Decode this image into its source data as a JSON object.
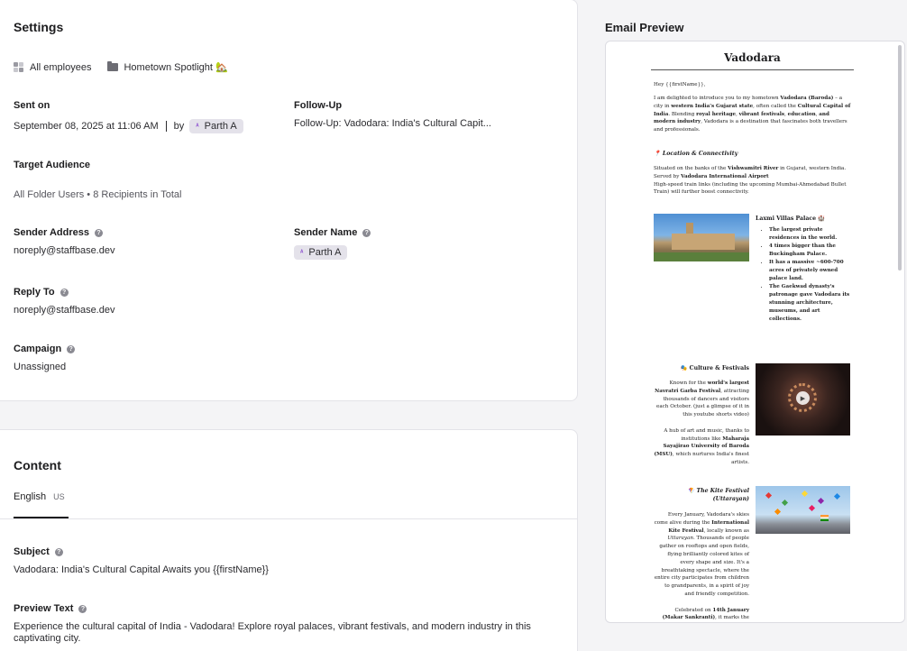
{
  "settings": {
    "title": "Settings",
    "audience_chip": "All employees",
    "folder_chip": "Hometown Spotlight 🏡",
    "sent_on_label": "Sent on",
    "sent_on_value": "September 08, 2025 at 11:06 AM",
    "by_label": "by",
    "author": "Parth A",
    "author_initials": "ᴬ",
    "followup_label": "Follow-Up",
    "followup_value": "Follow-Up: Vadodara: India's Cultural Capit...",
    "target_label": "Target Audience",
    "target_value": "All Folder Users • 8 Recipients in Total",
    "sender_address_label": "Sender Address",
    "sender_address_value": "noreply@staffbase.dev",
    "sender_name_label": "Sender Name",
    "sender_name_value": "Parth A",
    "reply_to_label": "Reply To",
    "reply_to_value": "noreply@staffbase.dev",
    "campaign_label": "Campaign",
    "campaign_value": "Unassigned"
  },
  "content": {
    "title": "Content",
    "tab_label": "English",
    "tab_locale": "US",
    "subject_label": "Subject",
    "subject_value": "Vadodara: India's Cultural Capital Awaits you {{firstName}}",
    "preview_label": "Preview Text",
    "preview_value": "Experience the cultural capital of India - Vadodara! Explore royal palaces, vibrant festivals, and modern industry in this captivating city."
  },
  "preview": {
    "title": "Email Preview",
    "email_title": "Vadodara",
    "greeting": "Hey {{firstName}},",
    "location_heading": "📍 Location & Connectivity",
    "palace_heading": "Laxmi Villas Palace 🏰",
    "palace_points": [
      "The largest private residences in the world.",
      "4 times bigger than the Buckingham Palace.",
      "It has a massive ~600-700 acres of privately owned palace land.",
      "The Gaekwad dynasty's patronage gave Vadodara its stunning architecture, museums, and art collections."
    ],
    "culture_heading": "🎭 Culture & Festivals",
    "kite_heading": "🪁 The Kite Festival (Uttarayan)"
  },
  "icons": {
    "help": "?",
    "play": "▶"
  }
}
